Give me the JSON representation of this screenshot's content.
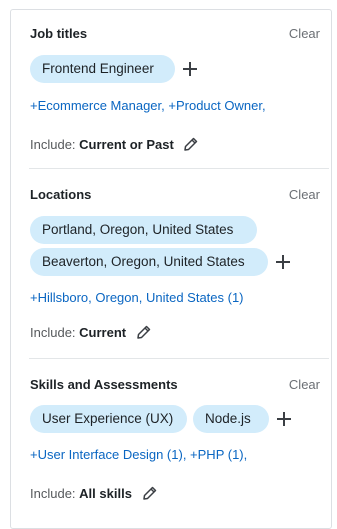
{
  "sections": [
    {
      "title": "Job titles",
      "clear": "Clear",
      "pills": [
        "Frontend Engineer"
      ],
      "suggestions": "+Ecommerce Manager, +Product Owner,",
      "include_prefix": "Include:",
      "include_value": "Current or Past"
    },
    {
      "title": "Locations",
      "clear": "Clear",
      "pills": [
        "Portland, Oregon, United States",
        "Beaverton, Oregon, United States"
      ],
      "suggestions": "+Hillsboro, Oregon, United States (1)",
      "include_prefix": "Include:",
      "include_value": "Current"
    },
    {
      "title": "Skills and Assessments",
      "clear": "Clear",
      "pills": [
        "User Experience (UX)",
        "Node.js"
      ],
      "suggestions": "+User Interface Design (1), +PHP (1),",
      "include_prefix": "Include:",
      "include_value": "All skills"
    }
  ],
  "icons": {
    "add": "plus-icon",
    "edit": "pencil-icon"
  },
  "colors": {
    "pill_bg": "#d2ecfb",
    "link": "#0a66c2",
    "divider": "#e3e6e8"
  }
}
